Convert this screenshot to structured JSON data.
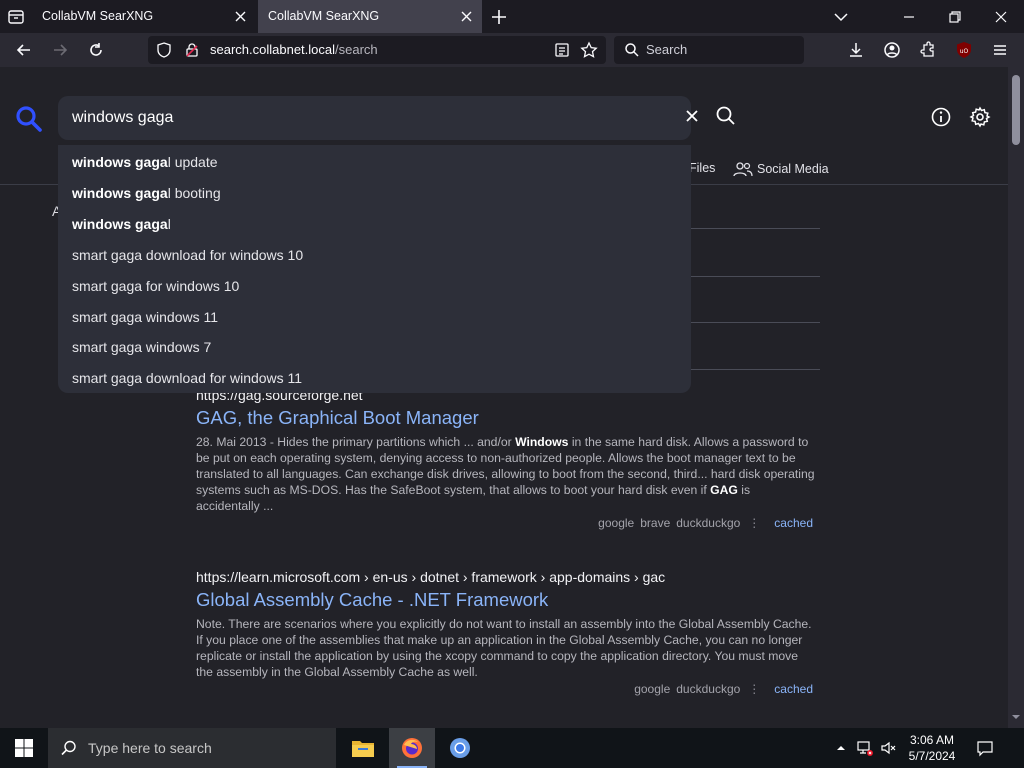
{
  "browser": {
    "tabs": [
      {
        "title": "CollabVM SearXNG",
        "active": false
      },
      {
        "title": "CollabVM SearXNG",
        "active": true
      }
    ],
    "url_host": "search.collabnet.local",
    "url_path": "/search",
    "search_placeholder": "Search"
  },
  "searxng": {
    "query": "windows gaga",
    "categories": [
      {
        "label": "Files",
        "icon": "file-icon"
      },
      {
        "label": "Social Media",
        "icon": "people-icon"
      }
    ],
    "stub_letter": "A",
    "autocomplete": [
      {
        "bold": "windows gaga",
        "rest": "l update"
      },
      {
        "bold": "windows gaga",
        "rest": "l booting"
      },
      {
        "bold": "windows gaga",
        "rest": "l"
      },
      {
        "bold": "",
        "rest": "smart gaga download for windows 10"
      },
      {
        "bold": "",
        "rest": "smart gaga for windows 10"
      },
      {
        "bold": "",
        "rest": "smart gaga windows 11"
      },
      {
        "bold": "",
        "rest": "smart gaga windows 7"
      },
      {
        "bold": "",
        "rest": "smart gaga download for windows 11"
      }
    ],
    "results": [
      {
        "url": "https://gag.sourceforge.net",
        "title": "GAG, the Graphical Boot Manager",
        "snippet_parts": [
          {
            "t": "28. Mai 2013 - Hides the primary partitions which ... and/or ",
            "b": false
          },
          {
            "t": "Windows",
            "b": true
          },
          {
            "t": " in the same hard disk. Allows a password to be put on each operating system, denying access to non-authorized people. Allows the boot manager text to be translated to all languages. Can exchange disk drives, allowing to boot from the second, third... hard disk operating systems such as MS-DOS. Has the SafeBoot system, that allows to boot your hard disk even if ",
            "b": false
          },
          {
            "t": "GAG",
            "b": true
          },
          {
            "t": " is accidentally ...",
            "b": false
          }
        ],
        "engines": [
          "google",
          "brave",
          "duckduckgo"
        ],
        "cached": "cached"
      },
      {
        "url": "https://learn.microsoft.com  › en-us › dotnet › framework › app-domains › gac",
        "title": "Global Assembly Cache - .NET Framework",
        "snippet_parts": [
          {
            "t": "Note. There are scenarios where you explicitly do not want to install an assembly into the Global Assembly Cache. If you place one of the assemblies that make up an application in the Global Assembly Cache, you can no longer replicate or install the application by using the xcopy command to copy the application directory. You must move the assembly in the Global Assembly Cache as well.",
            "b": false
          }
        ],
        "engines": [
          "google",
          "duckduckgo"
        ],
        "cached": "cached"
      }
    ]
  },
  "taskbar": {
    "search_placeholder": "Type here to search",
    "time": "3:06 AM",
    "date": "5/7/2024"
  },
  "colors": {
    "accent": "#8ab4f8",
    "logo": "#3050ff",
    "page_bg": "#222228"
  }
}
